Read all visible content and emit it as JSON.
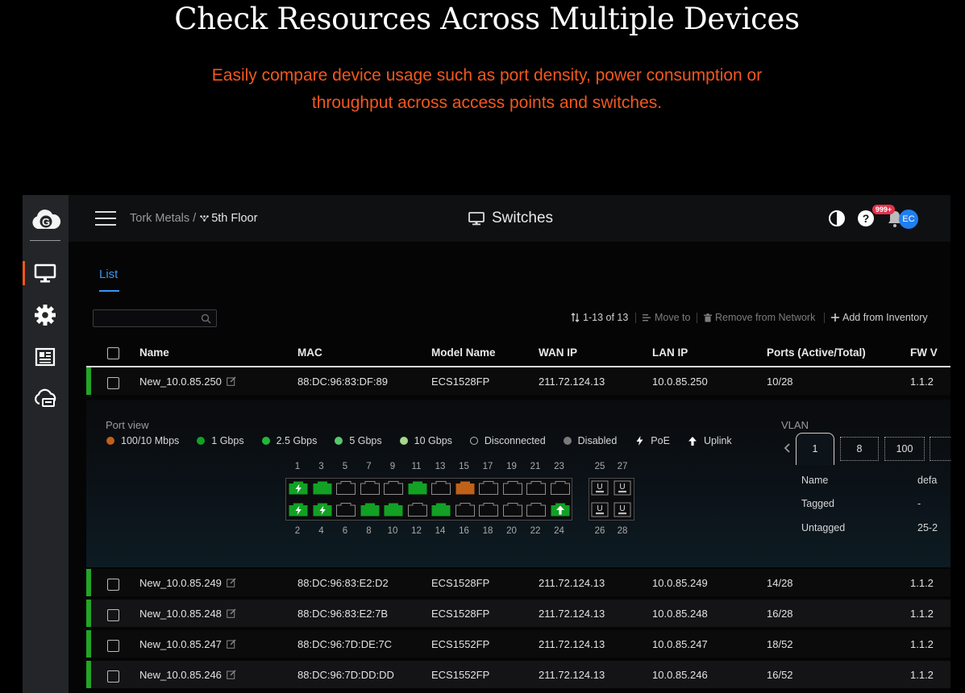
{
  "hero": {
    "title": "Check Resources Across Multiple Devices",
    "subtitle_line1": "Easily compare device usage such as port density, power consumption or",
    "subtitle_line2": "throughput across access points and switches."
  },
  "colors": {
    "accent_orange": "#f2581d",
    "link_blue": "#3c95f0",
    "online_green": "#22a526",
    "notification_red": "#e6324b",
    "avatar_blue": "#1f7ef0"
  },
  "sidebar": {
    "logo": "G",
    "items": [
      {
        "icon": "monitor-icon",
        "active": true
      },
      {
        "icon": "gear-icon",
        "active": false
      },
      {
        "icon": "newspaper-icon",
        "active": false
      },
      {
        "icon": "cloud-device-icon",
        "active": false
      }
    ]
  },
  "topbar": {
    "breadcrumb_org": "Tork Metals /",
    "breadcrumb_site": "5th Floor",
    "title": "Switches",
    "notification_count": "999+",
    "avatar_initials": "EC"
  },
  "tabs": [
    {
      "label": "List",
      "active": true
    }
  ],
  "search": {
    "placeholder": ""
  },
  "toolbar": {
    "count": "1-13 of 13",
    "move_to": "Move to",
    "remove": "Remove from Network",
    "add": "Add from Inventory"
  },
  "table": {
    "columns": [
      "Name",
      "MAC",
      "Model Name",
      "WAN IP",
      "LAN IP",
      "Ports (Active/Total)",
      "FW V"
    ],
    "rows": [
      {
        "name": "New_10.0.85.250",
        "mac": "88:DC:96:83:DF:89",
        "model": "ECS1528FP",
        "wan_ip": "211.72.124.13",
        "lan_ip": "10.0.85.250",
        "ports": "10/28",
        "fw": "1.1.2"
      },
      {
        "name": "New_10.0.85.249",
        "mac": "88:DC:96:83:E2:D2",
        "model": "ECS1528FP",
        "wan_ip": "211.72.124.13",
        "lan_ip": "10.0.85.249",
        "ports": "14/28",
        "fw": "1.1.2"
      },
      {
        "name": "New_10.0.85.248",
        "mac": "88:DC:96:83:E2:7B",
        "model": "ECS1528FP",
        "wan_ip": "211.72.124.13",
        "lan_ip": "10.0.85.248",
        "ports": "16/28",
        "fw": "1.1.2"
      },
      {
        "name": "New_10.0.85.247",
        "mac": "88:DC:96:7D:DE:7C",
        "model": "ECS1552FP",
        "wan_ip": "211.72.124.13",
        "lan_ip": "10.0.85.247",
        "ports": "18/52",
        "fw": "1.1.2"
      },
      {
        "name": "New_10.0.85.246",
        "mac": "88:DC:96:7D:DD:DD",
        "model": "ECS1552FP",
        "wan_ip": "211.72.124.13",
        "lan_ip": "10.0.85.246",
        "ports": "16/52",
        "fw": "1.1.2"
      }
    ]
  },
  "port_view": {
    "label": "Port view",
    "legend": [
      {
        "label": "100/10 Mbps",
        "kind": "dot",
        "color": "#c0611a"
      },
      {
        "label": "1 Gbps",
        "kind": "dot",
        "color": "#12a124"
      },
      {
        "label": "2.5 Gbps",
        "kind": "dot",
        "color": "#22b83a"
      },
      {
        "label": "5 Gbps",
        "kind": "dot",
        "color": "#56c86c"
      },
      {
        "label": "10 Gbps",
        "kind": "dot",
        "color": "#a6d58e"
      },
      {
        "label": "Disconnected",
        "kind": "ring",
        "color": "#bbbbbb"
      },
      {
        "label": "Disabled",
        "kind": "dot",
        "color": "#7a7a7a"
      },
      {
        "label": "PoE",
        "kind": "bolt",
        "color": "#ffffff"
      },
      {
        "label": "Uplink",
        "kind": "arrow",
        "color": "#ffffff"
      }
    ],
    "top_numbers": [
      "1",
      "3",
      "5",
      "7",
      "9",
      "11",
      "13",
      "15",
      "17",
      "19",
      "21",
      "23"
    ],
    "bottom_numbers": [
      "2",
      "4",
      "6",
      "8",
      "10",
      "12",
      "14",
      "16",
      "18",
      "20",
      "22",
      "24"
    ],
    "top_ports": [
      {
        "status": "1g",
        "poe": true
      },
      {
        "status": "1g",
        "poe": false
      },
      {
        "status": "disconnected"
      },
      {
        "status": "disconnected"
      },
      {
        "status": "disconnected"
      },
      {
        "status": "1g",
        "poe": false
      },
      {
        "status": "disconnected"
      },
      {
        "status": "100m",
        "poe": false
      },
      {
        "status": "disconnected"
      },
      {
        "status": "disconnected"
      },
      {
        "status": "disconnected"
      },
      {
        "status": "disconnected"
      }
    ],
    "bottom_ports": [
      {
        "status": "1g",
        "poe": true
      },
      {
        "status": "1g",
        "poe": true
      },
      {
        "status": "disconnected"
      },
      {
        "status": "1g",
        "poe": false
      },
      {
        "status": "1g",
        "poe": false
      },
      {
        "status": "disconnected"
      },
      {
        "status": "1g",
        "poe": false
      },
      {
        "status": "disconnected"
      },
      {
        "status": "disconnected"
      },
      {
        "status": "disconnected"
      },
      {
        "status": "disconnected"
      },
      {
        "status": "1g",
        "uplink": true
      }
    ],
    "sfp_top_numbers": [
      "25",
      "27"
    ],
    "sfp_bottom_numbers": [
      "26",
      "28"
    ],
    "sfp_label": "U"
  },
  "vlan": {
    "label": "VLAN",
    "tabs": [
      "1",
      "8",
      "100"
    ],
    "fields": [
      {
        "key": "Name",
        "value": "defa"
      },
      {
        "key": "Tagged",
        "value": "-"
      },
      {
        "key": "Untagged",
        "value": "25-2"
      }
    ]
  }
}
